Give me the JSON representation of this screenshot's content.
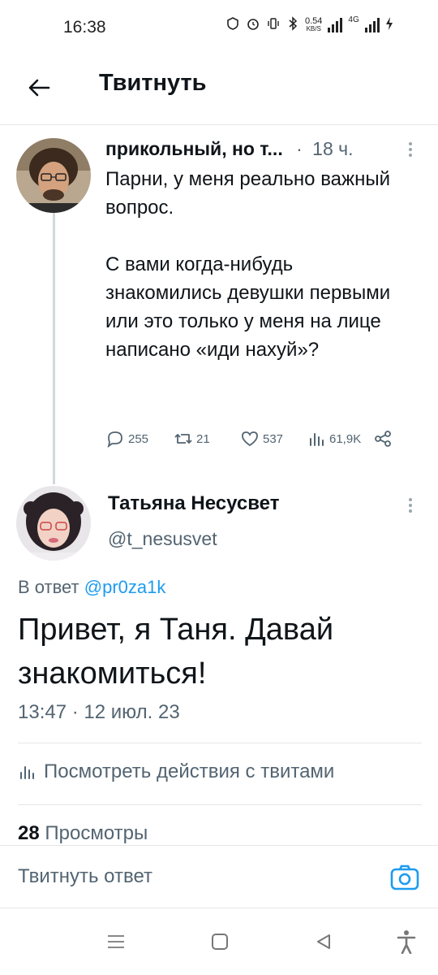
{
  "status_bar": {
    "time": "16:38",
    "net_speed_value": "0.54",
    "net_speed_unit": "KB/S",
    "network_type": "4G"
  },
  "header": {
    "title": "Твитнуть"
  },
  "tweet1": {
    "author": "прикольный, но т...",
    "separator": "·",
    "time": "18 ч.",
    "text_p1": "Парни, у меня реально важный вопрос.",
    "text_p2": "С вами когда-нибудь знакомились девушки первыми или это только у меня на лице написано «иди нахуй»?",
    "replies": "255",
    "retweets": "21",
    "likes": "537",
    "views": "61,9K"
  },
  "tweet2": {
    "name": "Татьяна Несусвет",
    "handle": "@t_nesusvet",
    "reply_prefix": "В ответ",
    "reply_mention": "@pr0za1k",
    "text": "Привет, я Таня. Давай знакомиться!",
    "timestamp": "13:47 · 12 июл. 23",
    "activity_label": "Посмотреть действия с твитами",
    "views_count": "28",
    "views_label": "Просмотры"
  },
  "reply_bar": {
    "placeholder": "Твитнуть ответ"
  },
  "colors": {
    "accent": "#1d9bf0",
    "text": "#0f1419",
    "secondary": "#536471",
    "divider": "#e6e6e6"
  },
  "icons": [
    "back-arrow-icon",
    "more-icon",
    "reply-icon",
    "retweet-icon",
    "like-icon",
    "views-icon",
    "share-icon",
    "camera-icon",
    "menu-icon",
    "home-icon",
    "back-nav-icon",
    "accessibility-icon"
  ]
}
